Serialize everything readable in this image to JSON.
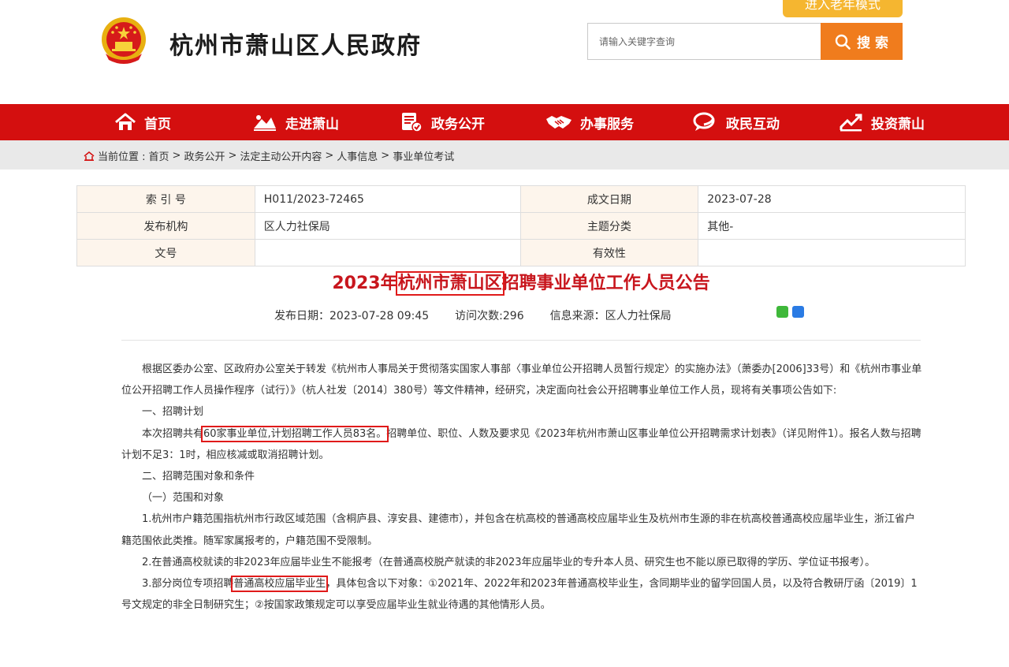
{
  "header": {
    "site_title": "杭州市萧山区人民政府",
    "elder_mode": "进入老年模式",
    "search_placeholder": "请输入关键字查询",
    "search_button": "搜 索"
  },
  "nav": {
    "items": [
      {
        "label": "首页",
        "icon": "home-icon"
      },
      {
        "label": "走进萧山",
        "icon": "landscape-icon"
      },
      {
        "label": "政务公开",
        "icon": "document-icon"
      },
      {
        "label": "办事服务",
        "icon": "handshake-icon"
      },
      {
        "label": "政民互动",
        "icon": "chat-icon"
      },
      {
        "label": "投资萧山",
        "icon": "chart-icon"
      }
    ]
  },
  "breadcrumb": {
    "prefix": "当前位置 :",
    "items": [
      "首页",
      "政务公开",
      "法定主动公开内容",
      "人事信息",
      "事业单位考试"
    ],
    "sep": " > "
  },
  "meta": {
    "index_label": "索 引 号",
    "index_value": "H011/2023-72465",
    "date_label": "成文日期",
    "date_value": "2023-07-28",
    "org_label": "发布机构",
    "org_value": "区人力社保局",
    "topic_label": "主题分类",
    "topic_value": "其他-",
    "docno_label": "文号",
    "docno_value": "",
    "valid_label": "有效性",
    "valid_value": ""
  },
  "article": {
    "title_pre": "2023年",
    "title_hl": "杭州市萧山区",
    "title_post": "招聘事业单位工作人员公告",
    "publish": "发布日期：2023-07-28 09:45",
    "visits": "访问次数:296",
    "source": "信息来源：区人力社保局",
    "p1": "根据区委办公室、区政府办公室关于转发《杭州市人事局关于贯彻落实国家人事部〈事业单位公开招聘人员暂行规定〉的实施办法》（萧委办[2006]33号）和《杭州市事业单位公开招聘工作人员操作程序（试行）》（杭人社发〔2014〕380号）等文件精神，经研究，决定面向社会公开招聘事业单位工作人员，现将有关事项公告如下:",
    "h1": "一、招聘计划",
    "p2_pre": "本次招聘共有",
    "p2_hl": "60家事业单位,计划招聘工作人员83名。",
    "p2_post": "招聘单位、职位、人数及要求见《2023年杭州市萧山区事业单位公开招聘需求计划表》（详见附件1）。报名人数与招聘计划不足3：1时，相应核减或取消招聘计划。",
    "h2": "二、招聘范围对象和条件",
    "h3": "（一）范围和对象",
    "p3": "1.杭州市户籍范围指杭州市行政区域范围（含桐庐县、淳安县、建德市），并包含在杭高校的普通高校应届毕业生及杭州市生源的非在杭高校普通高校应届毕业生，浙江省户籍范围依此类推。随军家属报考的，户籍范围不受限制。",
    "p4": "2.在普通高校就读的非2023年应届毕业生不能报考（在普通高校脱产就读的非2023年应届毕业的专升本人员、研究生也不能以原已取得的学历、学位证书报考）。",
    "p5_pre": "3.部分岗位专项招聘",
    "p5_hl": "普通高校应届毕业生",
    "p5_post": "，具体包含以下对象：①2021年、2022年和2023年普通高校毕业生，含同期毕业的留学回国人员，以及符合教研厅函〔2019〕1号文规定的非全日制研究生；②按国家政策规定可以享受应届毕业生就业待遇的其他情形人员。"
  },
  "colors": {
    "nav_red": "#d40f0f",
    "title_red": "#c8161d",
    "search_orange": "#f07c1d",
    "elder_yellow": "#f5b630"
  }
}
